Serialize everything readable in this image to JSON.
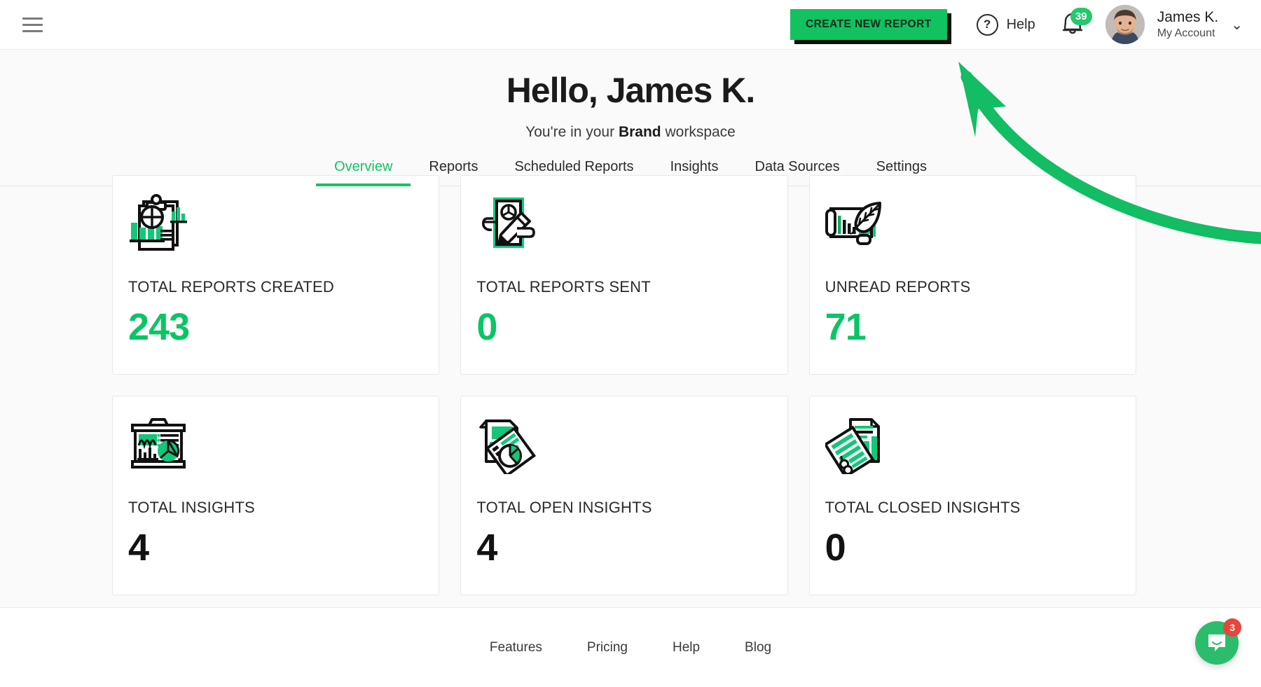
{
  "topbar": {
    "menu_icon": "hamburger-menu-icon",
    "create_button_label": "CREATE NEW REPORT",
    "help_label": "Help",
    "help_icon": "question-mark-circle-icon",
    "bell_icon": "notification-bell-icon",
    "notification_count": "39",
    "avatar_alt": "user-avatar",
    "account_name": "James K.",
    "account_sub": "My Account",
    "chevron_icon": "chevron-down-icon"
  },
  "hero": {
    "greeting": "Hello, James K.",
    "subtitle_pre": "You're in your ",
    "subtitle_bold": "Brand",
    "subtitle_post": " workspace"
  },
  "tabs": [
    {
      "label": "Overview",
      "active": true
    },
    {
      "label": "Reports",
      "active": false
    },
    {
      "label": "Scheduled Reports",
      "active": false
    },
    {
      "label": "Insights",
      "active": false
    },
    {
      "label": "Data Sources",
      "active": false
    },
    {
      "label": "Settings",
      "active": false
    }
  ],
  "cards": [
    {
      "label": "TOTAL REPORTS CREATED",
      "value": "243",
      "value_color": "green",
      "icon": "clipboard-chart-icon"
    },
    {
      "label": "TOTAL REPORTS SENT",
      "value": "0",
      "value_color": "green",
      "icon": "hand-document-pencil-icon"
    },
    {
      "label": "UNREAD REPORTS",
      "value": "71",
      "value_color": "green",
      "icon": "scroll-quill-icon"
    },
    {
      "label": "TOTAL INSIGHTS",
      "value": "4",
      "value_color": "dark",
      "icon": "presentation-board-icon"
    },
    {
      "label": "TOTAL OPEN INSIGHTS",
      "value": "4",
      "value_color": "dark",
      "icon": "documents-pie-icon"
    },
    {
      "label": "TOTAL CLOSED INSIGHTS",
      "value": "0",
      "value_color": "dark",
      "icon": "documents-bar-icon"
    }
  ],
  "footer": {
    "links": [
      "Features",
      "Pricing",
      "Help",
      "Blog"
    ]
  },
  "intercom": {
    "icon": "chat-bubble-smile-icon",
    "unread": "3"
  },
  "annotation": {
    "arrow_icon": "green-curved-arrow-annotation",
    "color": "#12bd63"
  },
  "colors": {
    "accent_green": "#12c160",
    "value_green": "#0bc565",
    "badge_red": "#e8453c",
    "page_bg": "#fafafa"
  }
}
